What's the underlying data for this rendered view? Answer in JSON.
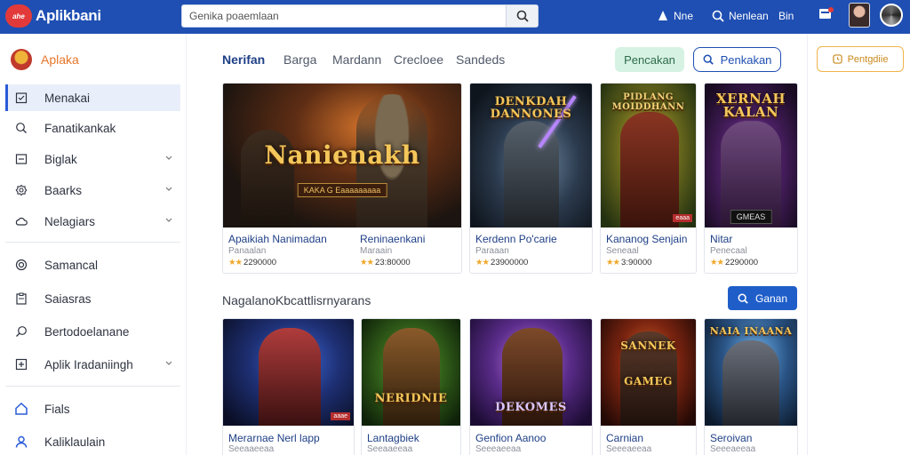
{
  "topbar": {
    "logo_text": "ahe",
    "app_title": "Aplikbani",
    "search_placeholder": "Genika poaemlaan",
    "user_label": "Nne",
    "search_label": "Nenlean",
    "bin_label": "Bin"
  },
  "sidebar": {
    "header": "Aplaka",
    "items": [
      {
        "label": "Menakai",
        "icon": "calendar-icon",
        "active": true
      },
      {
        "label": "Fanatikankak",
        "icon": "search-icon"
      },
      {
        "label": "Biglak",
        "icon": "box-icon",
        "chevron": true
      },
      {
        "label": "Baarks",
        "icon": "gear-icon",
        "chevron": true
      },
      {
        "label": "Nelagiars",
        "icon": "cloud-icon",
        "chevron": true
      },
      {
        "label": "Samancal",
        "icon": "disc-icon"
      },
      {
        "label": "Saiasras",
        "icon": "clipboard-icon"
      },
      {
        "label": "Bertodoelanane",
        "icon": "magnifier-icon"
      },
      {
        "label": "Aplik Iradaniingh",
        "icon": "chart-icon",
        "chevron": true
      },
      {
        "label": "Fials",
        "icon": "home-icon"
      },
      {
        "label": "Kaliklaulain",
        "icon": "user-icon"
      }
    ]
  },
  "tabs": [
    "Nerifan",
    "Barga",
    "Mardann",
    "Crecloee",
    "Sandeds"
  ],
  "actions": {
    "green_pill": "Pencakan",
    "outline_pill": "Penkakan",
    "orange_pill": "Pentgdiie"
  },
  "featured": [
    {
      "art_title": "Nanienakh",
      "art_sub": "KAKA G Eaaaaaaaaa",
      "title": "Apaikiah Nanimadan",
      "title2": "Reninaenkani",
      "sub": "Panaalan",
      "sub2": "Maraain",
      "rating": "2290000",
      "rating2": "23:80000"
    },
    {
      "art_title": "DENKDAH DANNONES",
      "title": "Kerdenn Po'carie",
      "sub": "Paraaan",
      "rating": "23900000"
    },
    {
      "art_title": "PIDLANG MOIDDHANN",
      "art_badge": "eaaa",
      "title": "Kananog Senjain",
      "sub": "Seneaal",
      "rating": "3:90000"
    },
    {
      "art_title": "XERNAH KALAN",
      "art_sub": "GMEAS",
      "title": "Nitar",
      "sub": "Penecaal",
      "rating": "2290000"
    }
  ],
  "section2": {
    "title": "NagalanoKbcattlisrnyarans",
    "button": "Ganan"
  },
  "row2": [
    {
      "art_badge": "aaae",
      "title": "Merarnae Nerl lapp",
      "sub": "Seeaaeeaa"
    },
    {
      "art_title": "NERIDNIE",
      "title": "Lantagbiek",
      "sub": "Seeaaeeaa"
    },
    {
      "art_title": "DEKOMES",
      "title": "Genfion Aanoo",
      "sub": "Seeeaeeaa"
    },
    {
      "art_title": "SANNEK GAMEG",
      "title": "Carnian",
      "sub": "Seeeaeeaa"
    },
    {
      "art_title": "NAIA INAANA",
      "title": "Seroivan",
      "sub": "Seeeaeeaa"
    }
  ]
}
